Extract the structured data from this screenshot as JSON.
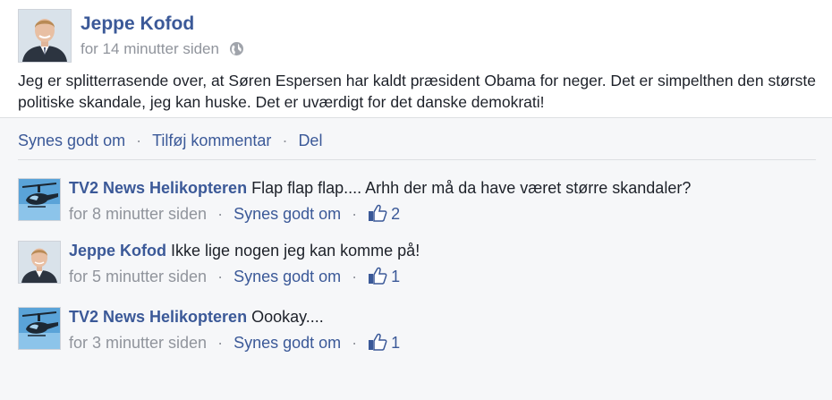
{
  "post": {
    "author": "Jeppe Kofod",
    "time": "for 14 minutter siden",
    "text": "Jeg er splitterrasende over, at Søren Espersen har kaldt præsident Obama for neger. Det er simpelthen den største politiske skandale, jeg kan huske. Det er uværdigt for det danske demokrati!"
  },
  "actions": {
    "like": "Synes godt om",
    "comment": "Tilføj kommentar",
    "share": "Del",
    "separator": "·"
  },
  "comments": [
    {
      "author": "TV2 News Helikopteren",
      "text": "Flap flap flap....  Arhh der må da have været større skandaler?",
      "time": "for 8 minutter siden",
      "like": "Synes godt om",
      "likes": "2",
      "avatar_icon": "helicopter-icon"
    },
    {
      "author": "Jeppe Kofod",
      "text": "Ikke lige nogen jeg kan komme på!",
      "time": "for 5 minutter siden",
      "like": "Synes godt om",
      "likes": "1",
      "avatar_icon": "person-photo"
    },
    {
      "author": "TV2 News Helikopteren",
      "text": "Oookay....",
      "time": "for 3 minutter siden",
      "like": "Synes godt om",
      "likes": "1",
      "avatar_icon": "helicopter-icon"
    }
  ],
  "colors": {
    "link": "#3b5998",
    "muted": "#90949c",
    "text": "#1d2129",
    "panel": "#f6f7f9"
  },
  "icons": {
    "privacy": "globe-icon",
    "like": "thumbs-up-icon"
  }
}
